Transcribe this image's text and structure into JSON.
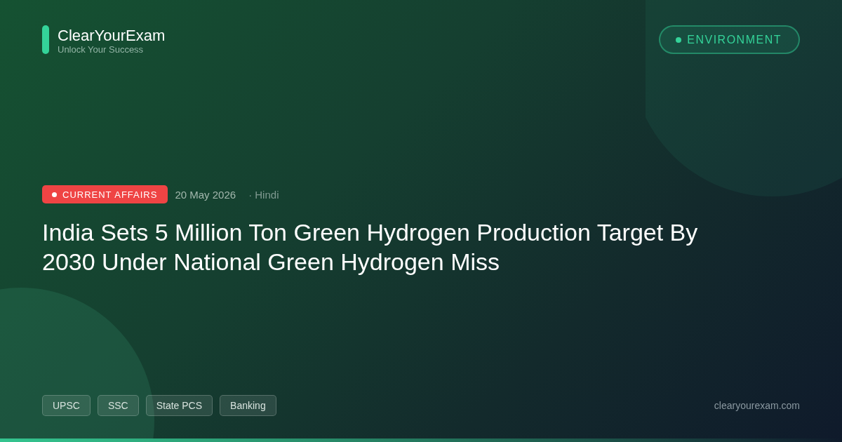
{
  "brand": {
    "name": "ClearYourExam",
    "tagline": "Unlock Your Success"
  },
  "category_pill": {
    "label": "ENVIRONMENT"
  },
  "meta": {
    "badge": "CURRENT AFFAIRS",
    "date": "20 May 2026",
    "language": "· Hindi"
  },
  "title": "India Sets 5 Million Ton Green Hydrogen Production Target By 2030 Under National Green Hydrogen Miss",
  "tags": [
    "UPSC",
    "SSC",
    "State PCS",
    "Banking"
  ],
  "website": "clearyourexam.com"
}
